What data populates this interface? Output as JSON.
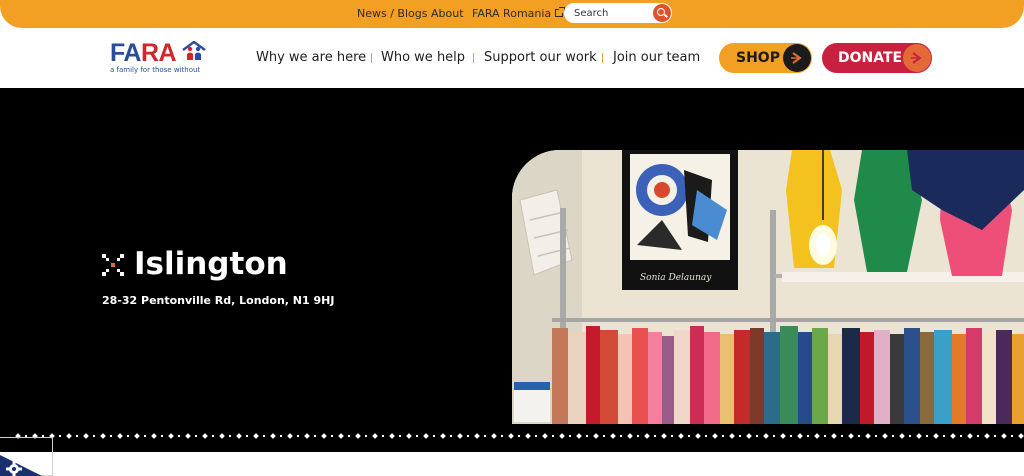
{
  "topbar": {
    "links": [
      "News / Blogs",
      "About",
      "FARA Romania"
    ],
    "search_placeholder": "Search"
  },
  "logo": {
    "wordmark_start": "FA",
    "wordmark_accent": "RA",
    "tagline": "a family for those without"
  },
  "nav": {
    "items": [
      "Why we are here",
      "Who we help",
      "Support our work",
      "Join our team"
    ]
  },
  "cta": {
    "shop_label": "SHOP",
    "donate_label": "DONATE"
  },
  "hero": {
    "title": "Islington",
    "address": "28-32 Pentonville Rd, London, N1 9HJ",
    "photo_sign": "Sonia Delaunay"
  },
  "colors": {
    "brand_orange": "#f2a024",
    "brand_blue": "#2a4d9b",
    "brand_red": "#c8213f",
    "accent_orange": "#e36a36"
  },
  "icons": [
    "search-icon",
    "external-link-icon",
    "arrow-right-icon",
    "location-mark-icon",
    "cookie-settings-icon"
  ]
}
